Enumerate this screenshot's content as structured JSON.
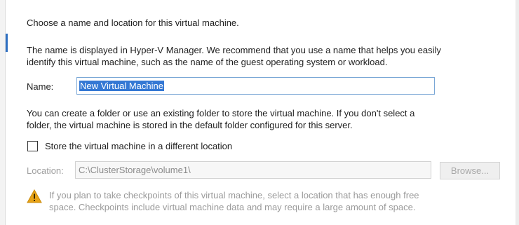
{
  "heading": "Choose a name and location for this virtual machine.",
  "name_description": {
    "line1": "The name is displayed in Hyper-V Manager. We recommend that you use a name that helps you easily",
    "line2": "identify this virtual machine, such as the name of the guest operating system or workload."
  },
  "name_field": {
    "label": "Name:",
    "value": "New Virtual Machine"
  },
  "folder_description": {
    "line1": "You can create a folder or use an existing folder to store the virtual machine. If you don't select a",
    "line2": "folder, the virtual machine is stored in the default folder configured for this server."
  },
  "store_checkbox": {
    "label": "Store the virtual machine in a different location",
    "checked": false
  },
  "location_field": {
    "label": "Location:",
    "value": "C:\\ClusterStorage\\volume1\\",
    "enabled": false
  },
  "browse_button": {
    "label": "Browse...",
    "enabled": false
  },
  "warning": {
    "icon": "warning-triangle-icon",
    "line1": "If you plan to take checkpoints of this virtual machine, select a location that has enough free",
    "line2": "space. Checkpoints include virtual machine data and may require a large amount of space."
  },
  "colors": {
    "accent": "#2e6fc2",
    "selection": "#3478d4",
    "warning": "#e8a317",
    "disabled_text": "#9a9a9a"
  }
}
